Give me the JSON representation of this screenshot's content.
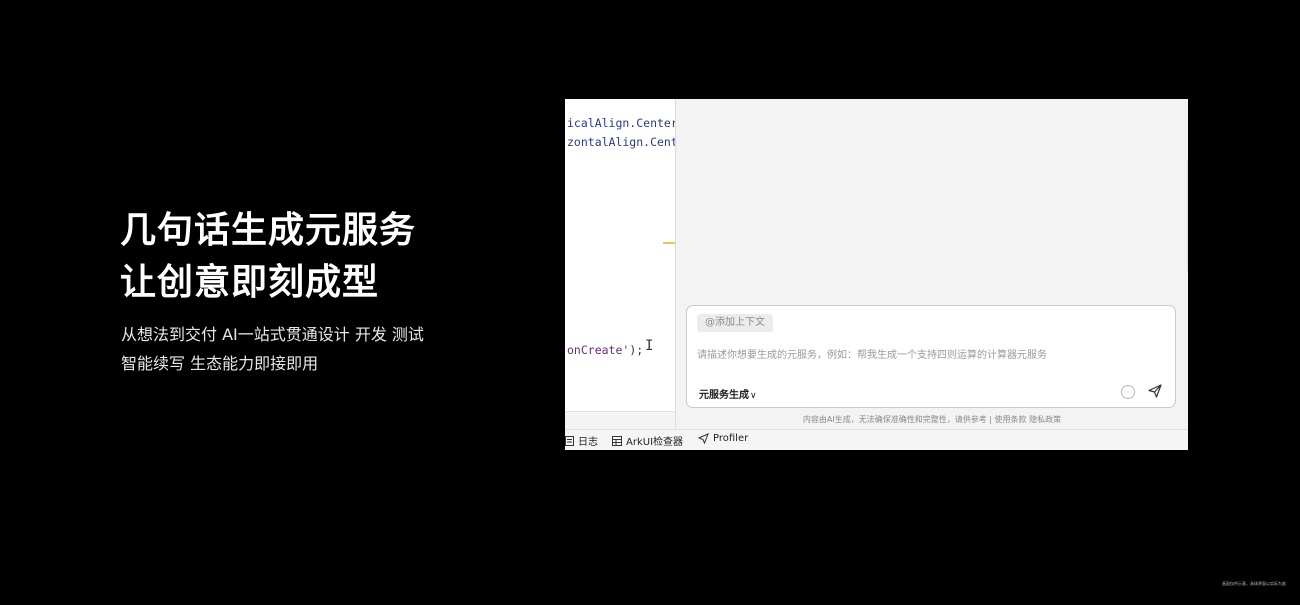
{
  "hero": {
    "title_line1": "几句话生成元服务",
    "title_line2": "让创意即刻成型",
    "subtitle_line1": "从想法到交付 AI一站式贯通设计 开发 测试",
    "subtitle_line2": "智能续写 生态能力即接即用"
  },
  "editor": {
    "code_line1": "icalAlign.Center",
    "code_line2": "zontalAlign.Cente",
    "code_line3_text": "onCreate'",
    "code_line3_punct": ");",
    "cursor": "I"
  },
  "chat": {
    "context_chip": "@添加上下文",
    "placeholder": "请描述你想要生成的元服务，例如：帮我生成一个支持四则运算的计算器元服务",
    "mode_label": "元服务生成",
    "mode_chevron": "∨",
    "disclaimer": "内容由AI生成，无法确保准确性和完整性，请供参考 | 使用条款 隐私政策"
  },
  "bottom_bar": {
    "items": [
      {
        "label": "日志",
        "icon": "log-icon"
      },
      {
        "label": "ArkUI检查器",
        "icon": "grid-icon"
      },
      {
        "label": "Profiler",
        "icon": "send-arrow-icon"
      }
    ]
  },
  "footnote": "画面仅供示意，具体界面以实际为准",
  "colors": {
    "background": "#000000",
    "accent_yellow": "#e8c74a",
    "input_border": "#c9c6de"
  }
}
